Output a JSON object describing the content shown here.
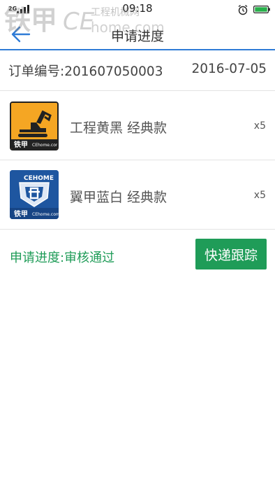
{
  "status_bar": {
    "network": "2G",
    "time": "09:18"
  },
  "header": {
    "title": "申请进度",
    "back_icon": "back-arrow-icon"
  },
  "order": {
    "number_label": "订单编号:201607050003",
    "date": "2016-07-05"
  },
  "products": [
    {
      "name": "工程黄黑 经典款",
      "quantity": "x5",
      "thumb_icon": "excavator-logo-icon"
    },
    {
      "name": "翼甲蓝白 经典款",
      "quantity": "x5",
      "thumb_icon": "cehome-shield-logo-icon"
    }
  ],
  "progress": {
    "label": "申请进度:审核通过"
  },
  "actions": {
    "track_label": "快递跟踪"
  },
  "watermark": {
    "brand": "铁甲",
    "site": "CEhome.com",
    "tagline": "工程机械网"
  },
  "colors": {
    "accent_blue": "#2f7bd6",
    "status_green": "#1f9c58",
    "thumb_yellow": "#f5a623",
    "thumb_blue": "#1e56a0"
  }
}
